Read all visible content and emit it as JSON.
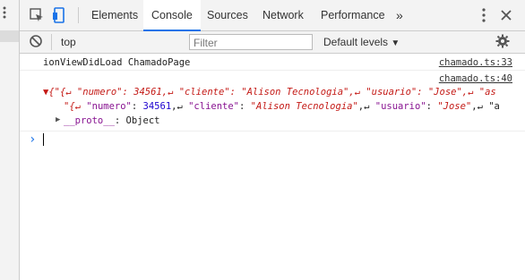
{
  "tabs": [
    "Elements",
    "Console",
    "Sources",
    "Network",
    "Performance"
  ],
  "more_tabs_icon": "»",
  "toolbar": {
    "context": "top",
    "filter_placeholder": "Filter",
    "levels": "Default levels"
  },
  "console": {
    "log1_text": "ionViewDidLoad ChamadoPage",
    "log1_src": "chamado.ts:33",
    "log2_src": "chamado.ts:40",
    "log2_line1": "▼{\"{↵ \"numero\": 34561,↵ \"cliente\": \"Alison Tecnologia\",↵ \"usuario\": \"Jose\",↵ \"as",
    "log2_line2_prefix": "\"{↵ ",
    "log2_line2_key1": "\"numero\"",
    "log2_line2_sep1": ": ",
    "log2_line2_num": "34561",
    "log2_line2_sep2": ",↵ ",
    "log2_line2_key2": "\"cliente\"",
    "log2_line2_sep3": ": ",
    "log2_line2_str1": "\"Alison Tecnologia\"",
    "log2_line2_sep4": ",↵ ",
    "log2_line2_key3": "\"usuario\"",
    "log2_line2_sep5": ": ",
    "log2_line2_str2": "\"Jose\"",
    "log2_line2_tail": ",↵ \"a",
    "proto_key": "__proto__",
    "proto_val": ": Object",
    "prompt": "›"
  }
}
